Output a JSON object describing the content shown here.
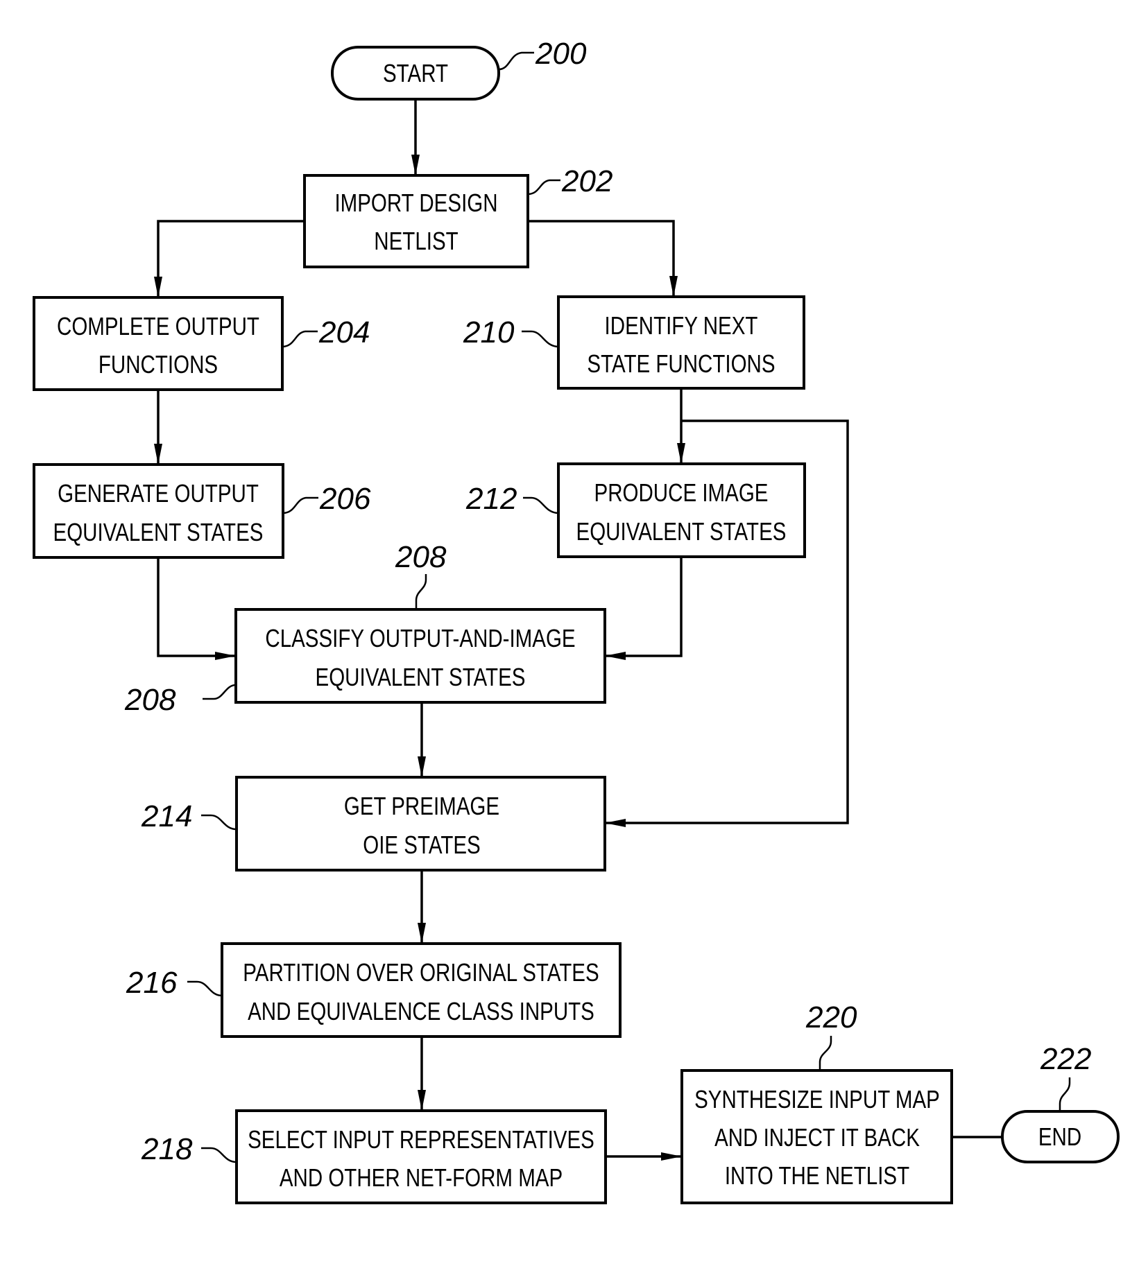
{
  "nodes": {
    "start": {
      "ref": "200",
      "lines": [
        "START"
      ]
    },
    "import": {
      "ref": "202",
      "lines": [
        "IMPORT DESIGN",
        "NETLIST"
      ]
    },
    "complete_output": {
      "ref": "204",
      "lines": [
        "COMPLETE OUTPUT",
        "FUNCTIONS"
      ]
    },
    "generate_output": {
      "ref": "206",
      "lines": [
        "GENERATE OUTPUT",
        "EQUIVALENT STATES"
      ]
    },
    "identify_next": {
      "ref": "210",
      "lines": [
        "IDENTIFY NEXT",
        "STATE FUNCTIONS"
      ]
    },
    "produce_image": {
      "ref": "212",
      "lines": [
        "PRODUCE IMAGE",
        "EQUIVALENT STATES"
      ]
    },
    "classify": {
      "ref": "208",
      "ref_top": "208",
      "lines": [
        "CLASSIFY OUTPUT-AND-IMAGE",
        "EQUIVALENT STATES"
      ]
    },
    "preimage": {
      "ref": "214",
      "lines": [
        "GET PREIMAGE",
        "OIE STATES"
      ]
    },
    "partition": {
      "ref": "216",
      "lines": [
        "PARTITION OVER ORIGINAL STATES",
        "AND EQUIVALENCE CLASS INPUTS"
      ]
    },
    "select": {
      "ref": "218",
      "lines": [
        "SELECT INPUT REPRESENTATIVES",
        "AND OTHER NET-FORM MAP"
      ]
    },
    "synthesize": {
      "ref": "220",
      "lines": [
        "SYNTHESIZE INPUT MAP",
        "AND INJECT IT BACK",
        "INTO THE NETLIST"
      ]
    },
    "end": {
      "ref": "222",
      "lines": [
        "END"
      ]
    }
  },
  "edges": [
    {
      "from": "START",
      "to": "IMPORT DESIGN NETLIST"
    },
    {
      "from": "IMPORT DESIGN NETLIST",
      "to": "COMPLETE OUTPUT FUNCTIONS"
    },
    {
      "from": "IMPORT DESIGN NETLIST",
      "to": "IDENTIFY NEXT STATE FUNCTIONS"
    },
    {
      "from": "COMPLETE OUTPUT FUNCTIONS",
      "to": "GENERATE OUTPUT EQUIVALENT STATES"
    },
    {
      "from": "IDENTIFY NEXT STATE FUNCTIONS",
      "to": "PRODUCE IMAGE EQUIVALENT STATES"
    },
    {
      "from": "IDENTIFY NEXT STATE FUNCTIONS",
      "to": "GET PREIMAGE OIE STATES"
    },
    {
      "from": "GENERATE OUTPUT EQUIVALENT STATES",
      "to": "CLASSIFY OUTPUT-AND-IMAGE EQUIVALENT STATES"
    },
    {
      "from": "PRODUCE IMAGE EQUIVALENT STATES",
      "to": "CLASSIFY OUTPUT-AND-IMAGE EQUIVALENT STATES"
    },
    {
      "from": "CLASSIFY OUTPUT-AND-IMAGE EQUIVALENT STATES",
      "to": "GET PREIMAGE OIE STATES"
    },
    {
      "from": "GET PREIMAGE OIE STATES",
      "to": "PARTITION OVER ORIGINAL STATES AND EQUIVALENCE CLASS INPUTS"
    },
    {
      "from": "PARTITION OVER ORIGINAL STATES AND EQUIVALENCE CLASS INPUTS",
      "to": "SELECT INPUT REPRESENTATIVES AND OTHER NET-FORM MAP"
    },
    {
      "from": "SELECT INPUT REPRESENTATIVES AND OTHER NET-FORM MAP",
      "to": "SYNTHESIZE INPUT MAP AND INJECT IT BACK INTO THE NETLIST"
    },
    {
      "from": "SYNTHESIZE INPUT MAP AND INJECT IT BACK INTO THE NETLIST",
      "to": "END"
    }
  ]
}
